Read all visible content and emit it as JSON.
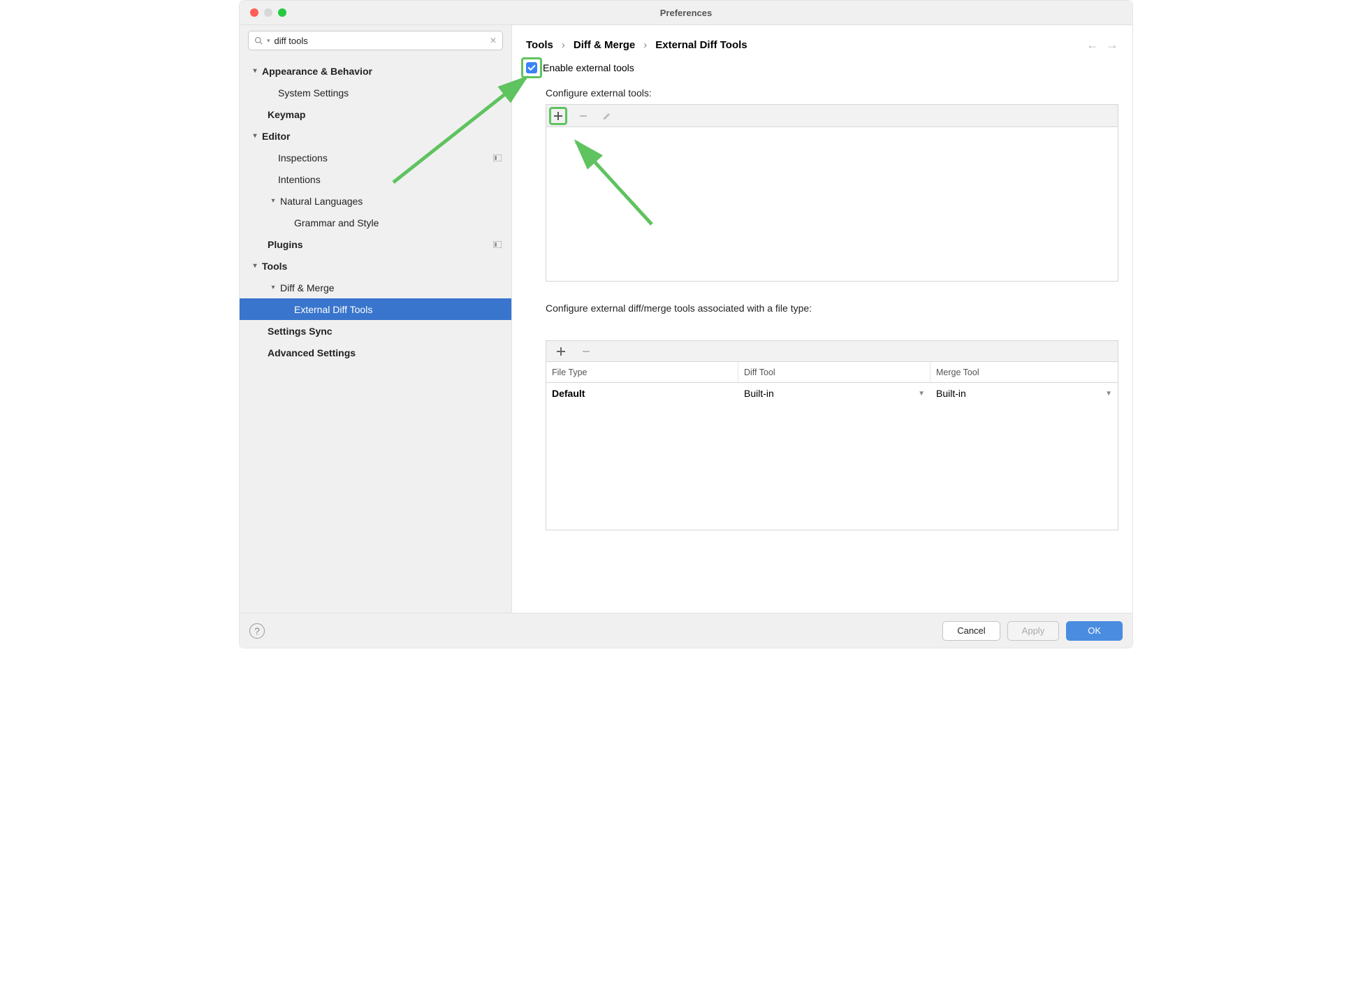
{
  "window": {
    "title": "Preferences"
  },
  "search": {
    "value": "diff tools"
  },
  "sidebar": {
    "items": [
      {
        "label": "Appearance & Behavior",
        "indent": 0,
        "bold": true,
        "arrow": "▾"
      },
      {
        "label": "System Settings",
        "indent": 1,
        "bold": false
      },
      {
        "label": "Keymap",
        "indent": 0,
        "bold": true,
        "noarrow": true,
        "pad": "1a"
      },
      {
        "label": "Editor",
        "indent": 0,
        "bold": true,
        "arrow": "▾"
      },
      {
        "label": "Inspections",
        "indent": 1,
        "bold": false,
        "badge": true
      },
      {
        "label": "Intentions",
        "indent": 1,
        "bold": false
      },
      {
        "label": "Natural Languages",
        "indent": 1,
        "bold": false,
        "arrow": "▾",
        "collapsible": true
      },
      {
        "label": "Grammar and Style",
        "indent": 2,
        "bold": false
      },
      {
        "label": "Plugins",
        "indent": 0,
        "bold": true,
        "noarrow": true,
        "pad": "1a",
        "badge": true
      },
      {
        "label": "Tools",
        "indent": 0,
        "bold": true,
        "arrow": "▾"
      },
      {
        "label": "Diff & Merge",
        "indent": 1,
        "bold": false,
        "arrow": "▾",
        "collapsible": true
      },
      {
        "label": "External Diff Tools",
        "indent": 2,
        "bold": false,
        "selected": true
      },
      {
        "label": "Settings Sync",
        "indent": 0,
        "bold": true,
        "noarrow": true,
        "pad": "1a"
      },
      {
        "label": "Advanced Settings",
        "indent": 0,
        "bold": true,
        "noarrow": true,
        "pad": "1a"
      }
    ]
  },
  "breadcrumb": [
    "Tools",
    "Diff & Merge",
    "External Diff Tools"
  ],
  "main": {
    "enable_label": "Enable external tools",
    "configure_tools_label": "Configure external tools:",
    "configure_filetype_label": "Configure external diff/merge tools associated with a file type:",
    "table_headers": {
      "file": "File Type",
      "diff": "Diff Tool",
      "merge": "Merge Tool"
    },
    "table_row": {
      "file": "Default",
      "diff": "Built-in",
      "merge": "Built-in"
    }
  },
  "buttons": {
    "cancel": "Cancel",
    "apply": "Apply",
    "ok": "OK"
  }
}
